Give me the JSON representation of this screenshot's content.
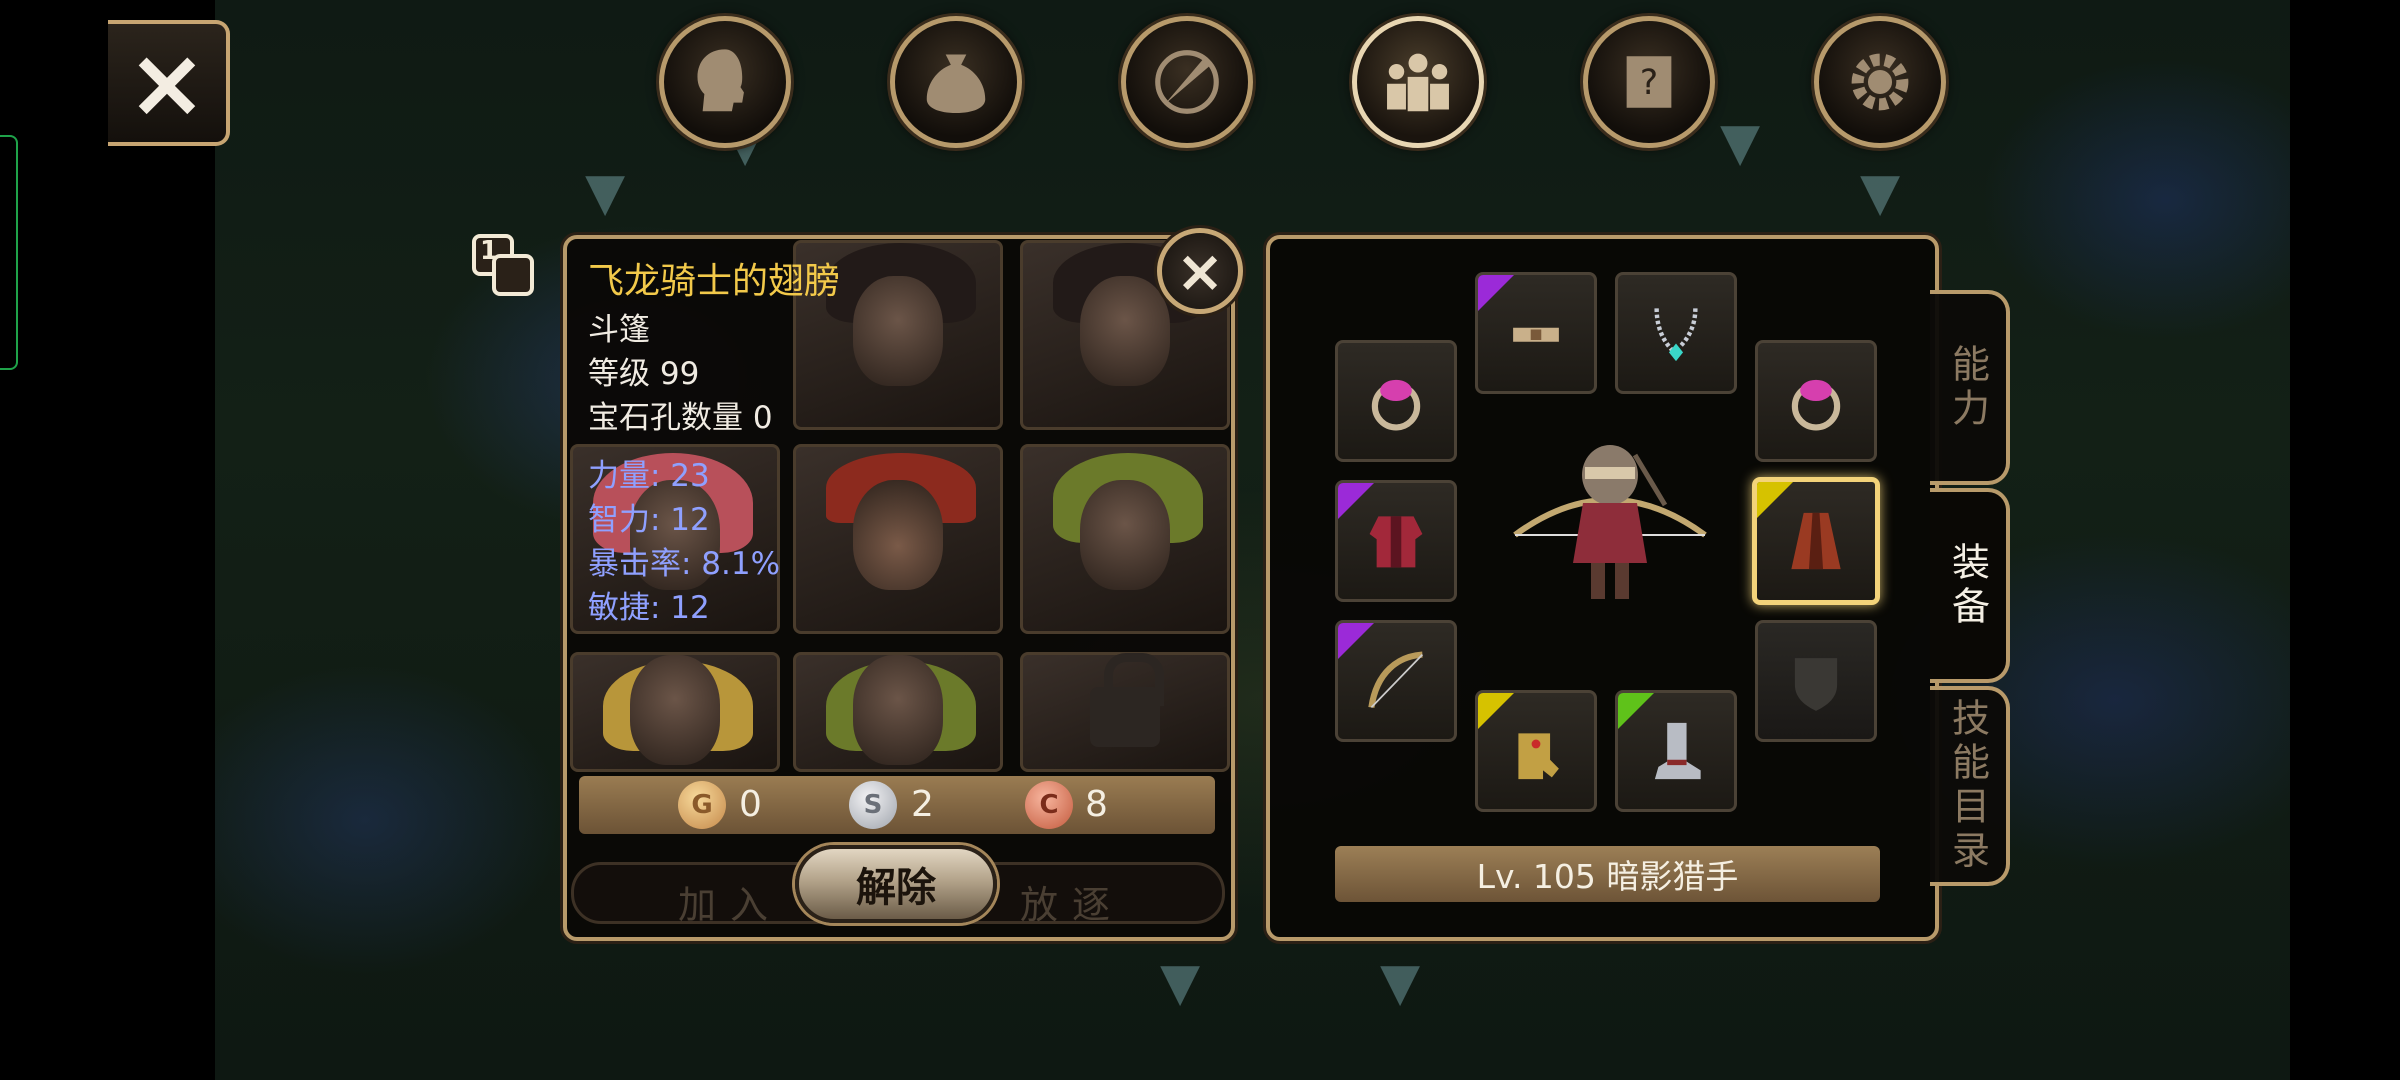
{
  "top_nav": {
    "close_label": "×",
    "icons": [
      "head-icon",
      "bag-icon",
      "compass-sword-icon",
      "party-icon",
      "quest-scroll-icon",
      "gear-icon"
    ],
    "active": "party-icon"
  },
  "item_tooltip": {
    "close_label": "×",
    "stack_count": "1",
    "name": "飞龙骑士的翅膀",
    "type": "斗篷",
    "level": "等级 99",
    "gem_slots": "宝石孔数量 0",
    "stats": [
      "力量: 23",
      "智力: 12",
      "暴击率: 8.1%",
      "敏捷: 12"
    ],
    "name_color": "#f2c94a",
    "stat_color": "#8fa0ff"
  },
  "currency": {
    "gold": {
      "symbol": "G",
      "value": "0"
    },
    "silver": {
      "symbol": "S",
      "value": "2"
    },
    "copper": {
      "symbol": "C",
      "value": "8"
    }
  },
  "party_actions": {
    "join_label": "加入",
    "expel_label": "放逐",
    "unequip_label": "解除"
  },
  "equipment": {
    "character_level_label": "Lv. 105 暗影猎手",
    "selected_slot": "cloak",
    "slots": [
      {
        "name": "ring-left",
        "icon": "ring-icon",
        "rarity": ""
      },
      {
        "name": "helmet",
        "icon": "bandana-icon",
        "rarity": "purple"
      },
      {
        "name": "necklace",
        "icon": "necklace-icon",
        "rarity": ""
      },
      {
        "name": "ring-right",
        "icon": "ring-icon",
        "rarity": ""
      },
      {
        "name": "armor",
        "icon": "armor-icon",
        "rarity": "purple"
      },
      {
        "name": "cloak",
        "icon": "cloak-icon",
        "rarity": "yellow"
      },
      {
        "name": "weapon",
        "icon": "bow-icon",
        "rarity": "purple"
      },
      {
        "name": "gloves",
        "icon": "gauntlet-icon",
        "rarity": "yellow"
      },
      {
        "name": "boots",
        "icon": "boot-icon",
        "rarity": "green"
      },
      {
        "name": "offhand",
        "icon": "shield-empty-icon",
        "rarity": ""
      }
    ]
  },
  "side_tabs": [
    {
      "label": "能力",
      "active": false
    },
    {
      "label": "装备",
      "active": true
    },
    {
      "label": "技能目录",
      "active": false
    }
  ]
}
